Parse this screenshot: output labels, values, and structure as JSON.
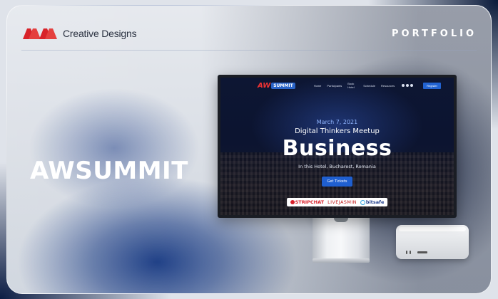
{
  "header": {
    "brand_name": "Creative Designs",
    "section_label": "PORTFOLIO"
  },
  "project": {
    "title": "AWSUMMIT"
  },
  "website": {
    "logo_text_a": "AW",
    "logo_text_b": "SUMMIT",
    "nav": [
      "Home",
      "Participants",
      "Book Hotel",
      "Schedule",
      "Resources"
    ],
    "register_label": "Register",
    "date": "March 7, 2021",
    "event_name": "Digital Thinkers Meetup",
    "headline": "Business",
    "location": "In this Hotel, Bucharest, Romania",
    "cta_label": "Get Tickets",
    "sponsors": [
      "STRIPCHAT",
      "LIVEJASMIN",
      "bitsafe"
    ]
  },
  "colors": {
    "accent_red": "#e33333",
    "accent_blue": "#2263d1",
    "navy": "#0b1730"
  }
}
